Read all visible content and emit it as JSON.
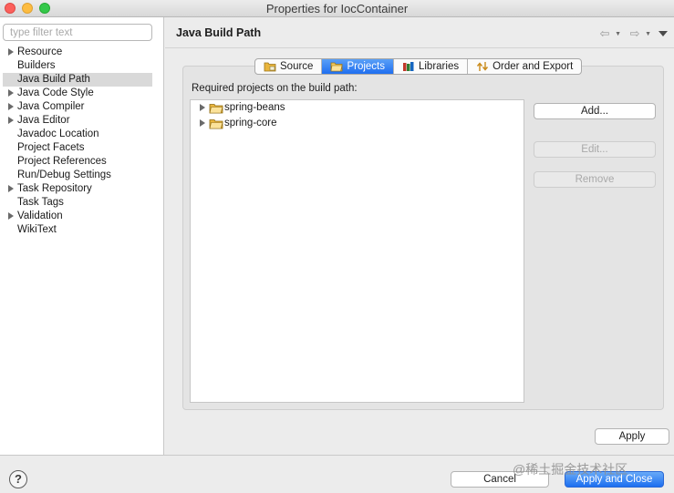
{
  "window": {
    "title": "Properties for IocContainer"
  },
  "sidebar": {
    "filter_placeholder": "type filter text",
    "items": [
      {
        "label": "Resource",
        "expandable": true
      },
      {
        "label": "Builders",
        "expandable": false
      },
      {
        "label": "Java Build Path",
        "expandable": false,
        "selected": true
      },
      {
        "label": "Java Code Style",
        "expandable": true
      },
      {
        "label": "Java Compiler",
        "expandable": true
      },
      {
        "label": "Java Editor",
        "expandable": true
      },
      {
        "label": "Javadoc Location",
        "expandable": false
      },
      {
        "label": "Project Facets",
        "expandable": false
      },
      {
        "label": "Project References",
        "expandable": false
      },
      {
        "label": "Run/Debug Settings",
        "expandable": false
      },
      {
        "label": "Task Repository",
        "expandable": true
      },
      {
        "label": "Task Tags",
        "expandable": false
      },
      {
        "label": "Validation",
        "expandable": true
      },
      {
        "label": "WikiText",
        "expandable": false
      }
    ]
  },
  "main": {
    "title": "Java Build Path",
    "tabs": [
      {
        "label": "Source",
        "icon": "source-folder-icon"
      },
      {
        "label": "Projects",
        "icon": "projects-folder-icon",
        "active": true
      },
      {
        "label": "Libraries",
        "icon": "libraries-icon"
      },
      {
        "label": "Order and Export",
        "icon": "order-export-icon"
      }
    ],
    "required_label": "Required projects on the build path:",
    "projects": [
      {
        "name": "spring-beans"
      },
      {
        "name": "spring-core"
      }
    ],
    "buttons": {
      "add": "Add...",
      "edit": "Edit...",
      "remove": "Remove",
      "apply": "Apply"
    }
  },
  "footer": {
    "help": "?",
    "cancel": "Cancel",
    "apply_and_close": "Apply and Close",
    "watermark": "@稀土掘金技术社区"
  },
  "colors": {
    "accent": "#1f6ef0",
    "selection": "#d9d9d9",
    "folder": "#e9b53c"
  }
}
